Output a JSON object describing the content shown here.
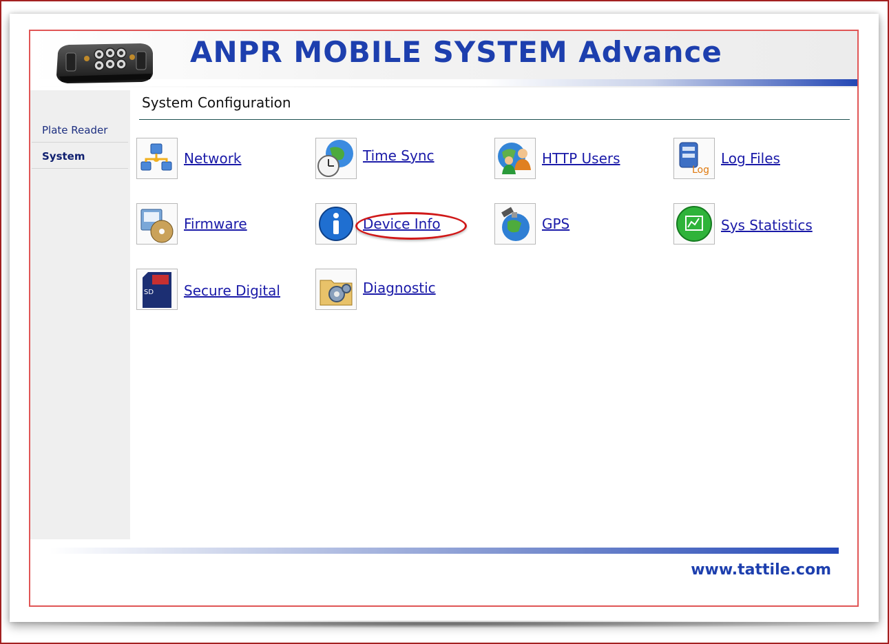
{
  "header": {
    "title": "ANPR MOBILE SYSTEM Advance",
    "device_image": "anpr-camera-unit"
  },
  "sidebar": {
    "items": [
      {
        "label": "Plate Reader",
        "active": false
      },
      {
        "label": "System",
        "active": true
      }
    ]
  },
  "main": {
    "title": "System Configuration",
    "items": [
      {
        "label": "Network",
        "icon": "network-icon"
      },
      {
        "label": "Time Sync",
        "icon": "globe-clock-icon"
      },
      {
        "label": "HTTP Users",
        "icon": "users-globe-icon"
      },
      {
        "label": "Log Files",
        "icon": "log-files-icon"
      },
      {
        "label": "Firmware",
        "icon": "firmware-disc-icon"
      },
      {
        "label": "Device Info",
        "icon": "info-icon",
        "highlighted": true
      },
      {
        "label": "GPS",
        "icon": "satellite-globe-icon"
      },
      {
        "label": "Sys Statistics",
        "icon": "statistics-icon"
      },
      {
        "label": "Secure Digital",
        "icon": "sd-card-icon"
      },
      {
        "label": "Diagnostic",
        "icon": "diagnostic-gears-icon"
      }
    ]
  },
  "footer": {
    "website": "www.tattile.com"
  },
  "colors": {
    "brand_blue": "#1d3fae",
    "link_blue": "#1a1aa8",
    "highlight_red": "#d01818",
    "frame_red": "#e05555"
  }
}
